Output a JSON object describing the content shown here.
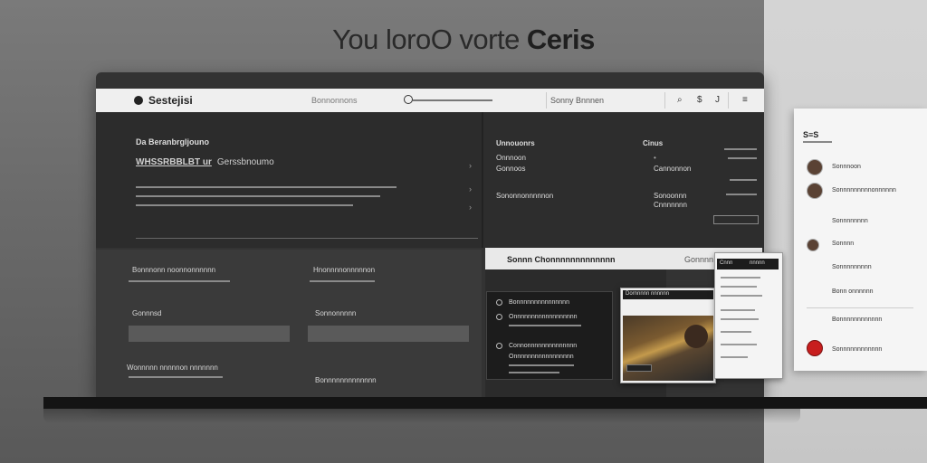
{
  "headline": {
    "part1": "You loroO  vorte",
    "part2": "Ceris"
  },
  "topbar": {
    "brand": "Sestejisi",
    "nav_item": "Bonnonnons",
    "nav_item_2": "Sonny Bnnnen",
    "icon1": "⌕",
    "icon2": "$",
    "icon3": "J"
  },
  "left_panel": {
    "title": "Da Beranbrgljouno",
    "subtitle_bold": "WHSSRBBLBT ur",
    "subtitle_rest": "Gerssbnoumo"
  },
  "mid_panel": {
    "col1_title": "Unnouonrs",
    "col1_items": [
      "Onnnoon",
      "Gonnoos",
      "Sononnonnnnnon"
    ],
    "col2_title": "Cinus",
    "col2_items": [
      "Cannonnon",
      "Sonoonnn",
      "Cnnnnnnn"
    ]
  },
  "bottom_left": {
    "labels": [
      "Bonnnonn noonnonnnnnn",
      "Hnonnnnonnnnnon",
      "Gonnnsd",
      "Sonnonnnnn",
      "Wonnnnn nnnnnon nnnnnnn",
      "Bonnnnnnnnnnnnn"
    ]
  },
  "card_strip": {
    "title": "Sonnn Chonnnnnnnnnnnnn",
    "right": "Gonnnn"
  },
  "card_list": {
    "items": [
      "Bonnnnnnnnnnnnnnn",
      "Onnnnnnnnnnnnnnnnnn",
      "Connonnnnnnnnnnnnnn",
      "Onnnnnnnnnnnnnnnnn"
    ]
  },
  "photo_card": {
    "header": "Dornnnnn nnnnnn"
  },
  "doc_card": {
    "header_left": "Cnnn",
    "header_right": "nnnnn"
  },
  "side_card": {
    "title": "S≡S",
    "items": [
      "Sonnnoon",
      "Sonnnnnnnnnonnnnnn",
      "Sonnnnnnnn",
      "Sonnnn",
      "Sonnnnnnnnn",
      "Bonn onnnnnn",
      "Bonnnnnnnnnnnn",
      "Sonnnnnnnnnnnn"
    ]
  }
}
